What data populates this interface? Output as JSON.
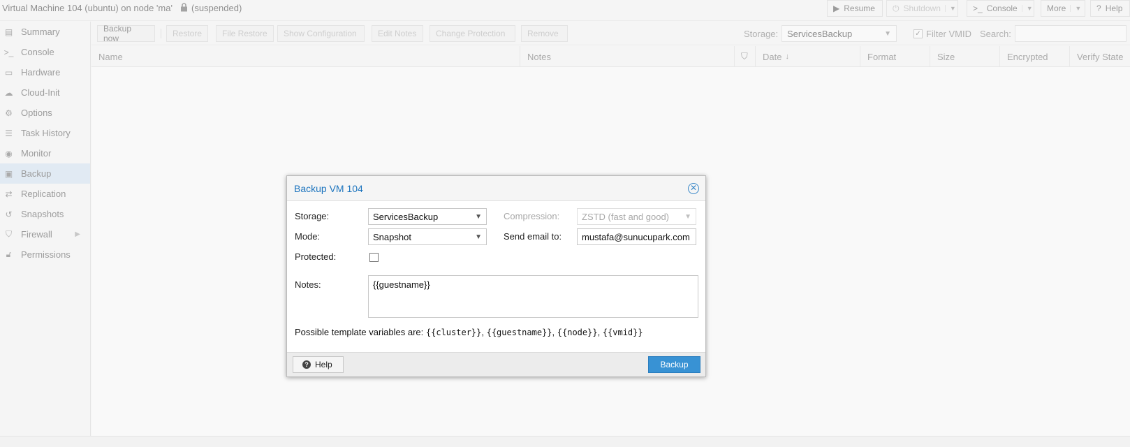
{
  "window": {
    "title": "Virtual Machine 104 (ubuntu) on node 'ma'",
    "status": "(suspended)",
    "buttons": {
      "resume": "Resume",
      "shutdown": "Shutdown",
      "console": "Console",
      "more": "More",
      "help": "Help"
    }
  },
  "sidebar": {
    "items": [
      {
        "label": "Summary",
        "icon": "book-icon"
      },
      {
        "label": "Console",
        "icon": "terminal-icon"
      },
      {
        "label": "Hardware",
        "icon": "monitor-icon"
      },
      {
        "label": "Cloud-Init",
        "icon": "cloud-icon"
      },
      {
        "label": "Options",
        "icon": "gear-icon"
      },
      {
        "label": "Task History",
        "icon": "list-icon"
      },
      {
        "label": "Monitor",
        "icon": "eye-icon"
      },
      {
        "label": "Backup",
        "icon": "floppy-icon"
      },
      {
        "label": "Replication",
        "icon": "retweet-icon"
      },
      {
        "label": "Snapshots",
        "icon": "history-icon"
      },
      {
        "label": "Firewall",
        "icon": "shield-icon"
      },
      {
        "label": "Permissions",
        "icon": "unlock-icon"
      }
    ],
    "active": "Backup"
  },
  "toolbar": {
    "backup_now": "Backup now",
    "restore": "Restore",
    "file_restore": "File Restore",
    "show_configuration": "Show Configuration",
    "edit_notes": "Edit Notes",
    "change_protection": "Change Protection",
    "remove": "Remove",
    "storage_label": "Storage:",
    "storage_value": "ServicesBackup",
    "filter_vmid": "Filter VMID",
    "search_label": "Search:"
  },
  "grid": {
    "columns": [
      "Name",
      "Notes",
      "",
      "Date",
      "Format",
      "Size",
      "Encrypted",
      "Verify State"
    ]
  },
  "dialog": {
    "title": "Backup VM 104",
    "storage_label": "Storage:",
    "storage_value": "ServicesBackup",
    "mode_label": "Mode:",
    "mode_value": "Snapshot",
    "protected_label": "Protected:",
    "compression_label": "Compression:",
    "compression_value": "ZSTD (fast and good)",
    "email_label": "Send email to:",
    "email_value": "mustafa@sunucupark.com",
    "notes_label": "Notes:",
    "notes_value": "{{guestname}}",
    "hint_prefix": "Possible template variables are:",
    "hint_vars": [
      "{{cluster}}",
      "{{guestname}}",
      "{{node}}",
      "{{vmid}}"
    ],
    "help_button": "Help",
    "backup_button": "Backup"
  }
}
